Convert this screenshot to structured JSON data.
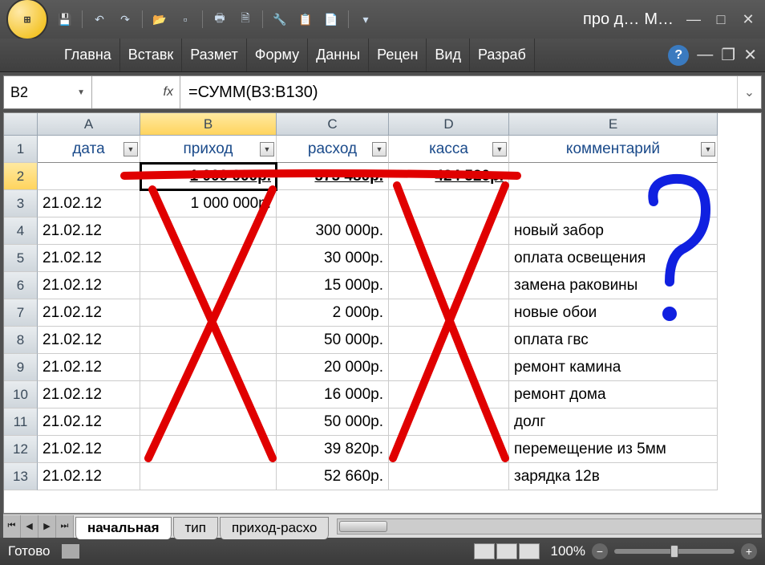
{
  "title": {
    "doc": "про д…",
    "app": "M…"
  },
  "ribbon_tabs": [
    "Главна",
    "Вставк",
    "Размет",
    "Форму",
    "Данны",
    "Рецен",
    "Вид",
    "Разраб"
  ],
  "name_box": "B2",
  "formula": "=СУММ(B3:B130)",
  "columns": [
    "A",
    "B",
    "C",
    "D",
    "E"
  ],
  "headers": {
    "A": "дата",
    "B": "приход",
    "C": "расход",
    "D": "касса",
    "E": "комментарий"
  },
  "rows": [
    {
      "n": 2,
      "A": "",
      "B": "1 000 000р.",
      "C": "575 480р.",
      "D": "424 520р.",
      "E": ""
    },
    {
      "n": 3,
      "A": "21.02.12",
      "B": "1 000 000р.",
      "C": "",
      "D": "",
      "E": ""
    },
    {
      "n": 4,
      "A": "21.02.12",
      "B": "",
      "C": "300 000р.",
      "D": "",
      "E": "новый забор"
    },
    {
      "n": 5,
      "A": "21.02.12",
      "B": "",
      "C": "30 000р.",
      "D": "",
      "E": "оплата освещения"
    },
    {
      "n": 6,
      "A": "21.02.12",
      "B": "",
      "C": "15 000р.",
      "D": "",
      "E": "замена раковины"
    },
    {
      "n": 7,
      "A": "21.02.12",
      "B": "",
      "C": "2 000р.",
      "D": "",
      "E": "новые обои"
    },
    {
      "n": 8,
      "A": "21.02.12",
      "B": "",
      "C": "50 000р.",
      "D": "",
      "E": "оплата гвс"
    },
    {
      "n": 9,
      "A": "21.02.12",
      "B": "",
      "C": "20 000р.",
      "D": "",
      "E": "ремонт камина"
    },
    {
      "n": 10,
      "A": "21.02.12",
      "B": "",
      "C": "16 000р.",
      "D": "",
      "E": "ремонт дома"
    },
    {
      "n": 11,
      "A": "21.02.12",
      "B": "",
      "C": "50 000р.",
      "D": "",
      "E": "долг"
    },
    {
      "n": 12,
      "A": "21.02.12",
      "B": "",
      "C": "39 820р.",
      "D": "",
      "E": "перемещение из 5мм"
    },
    {
      "n": 13,
      "A": "21.02.12",
      "B": "",
      "C": "52 660р.",
      "D": "",
      "E": "зарядка 12в"
    }
  ],
  "sheet_tabs": [
    "начальная",
    "тип",
    "приход-расхо"
  ],
  "active_sheet": 0,
  "status": "Готово",
  "zoom": "100%",
  "selected_column": "B",
  "selected_row": 2
}
